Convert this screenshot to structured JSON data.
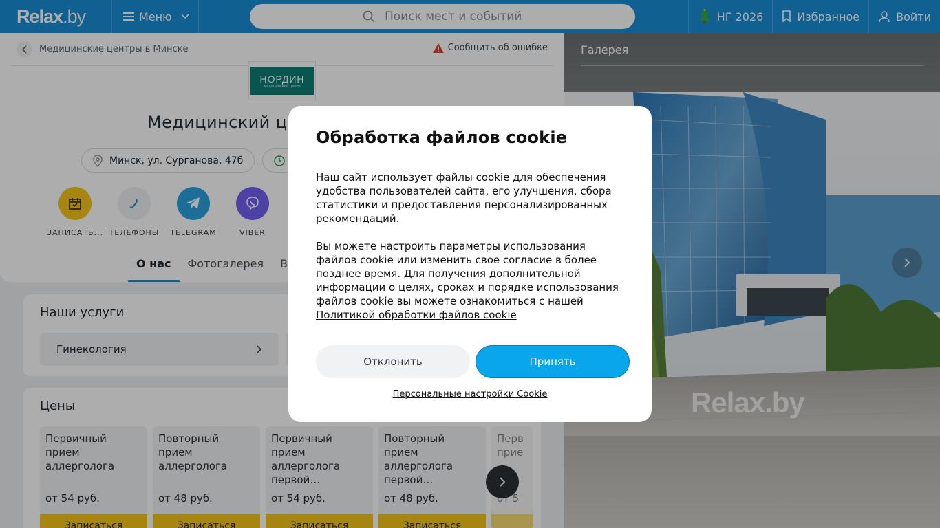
{
  "header": {
    "logo_main": "Relax",
    "logo_suffix": ".by",
    "menu_label": "Меню",
    "search_placeholder": "Поиск мест и событий",
    "ng_label": "НГ 2026",
    "favorites_label": "Избранное",
    "login_label": "Войти"
  },
  "page": {
    "breadcrumb": "Медицинские центры в Минске",
    "report_error": "Сообщить об ошибке",
    "brand_logo_text": "НОРДИН",
    "brand_logo_sub": "медицинский центр",
    "title": "Медицинский це",
    "address": "Минск, ул. Сурганова, 47б",
    "actions": [
      {
        "label": "ЗАПИСАТЬ...",
        "icon": "calendar-icon",
        "color": "#f5c518"
      },
      {
        "label": "ТЕЛЕФОНЫ",
        "icon": "phone-icon",
        "color": "#eef0f2"
      },
      {
        "label": "TELEGRAM",
        "icon": "telegram-icon",
        "color": "#2aa3df"
      },
      {
        "label": "VIBER",
        "icon": "viber-icon",
        "color": "#7360f2"
      }
    ],
    "tabs": [
      "О нас",
      "Фотогалерея",
      "Ви"
    ],
    "services_title": "Наши услуги",
    "services": [
      "Гинекология"
    ],
    "prices_title": "Цены",
    "prices": [
      {
        "name": "Первичный прием аллерголога",
        "price": "от 54 руб.",
        "book": "Записаться"
      },
      {
        "name": "Повторный прием аллерголога",
        "price": "от 48 руб.",
        "book": "Записаться"
      },
      {
        "name": "Первичный прием аллерголога первой…",
        "price": "от 54 руб.",
        "book": "Записаться"
      },
      {
        "name": "Повторный прием аллерголога первой…",
        "price": "от 48 руб.",
        "book": "Записаться"
      },
      {
        "name": "Перв прие",
        "price": "от 5",
        "book": ""
      }
    ]
  },
  "gallery": {
    "title": "Галерея",
    "watermark": "Relax.by"
  },
  "cookie": {
    "title": "Обработка файлов cookie",
    "text1": "Наш сайт использует файлы cookie для обеспечения удобства пользователей сайта, его улучшения, сбора статистики и предоставления персонализированных рекомендаций.",
    "text2": "Вы можете настроить параметры использования файлов cookie или изменить свое согласие в более позднее время. Для получения дополнительной информации о целях, сроках и порядке использования файлов cookie вы можете ознакомиться с нашей",
    "policy_link": "Политикой обработки файлов cookie",
    "decline": "Отклонить",
    "accept": "Принять",
    "personal": "Персональные настройки Cookie"
  },
  "colors": {
    "brand_blue": "#1a8ed8",
    "accept_blue": "#0aa6ec",
    "book_yellow": "#f5c518"
  }
}
